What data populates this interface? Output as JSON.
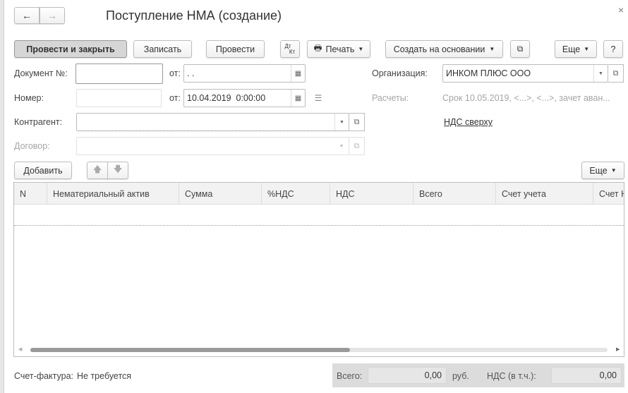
{
  "window": {
    "title": "Поступление НМА (создание)",
    "close": "×"
  },
  "toolbar": {
    "post_close": "Провести и закрыть",
    "save": "Записать",
    "post": "Провести",
    "dtkt_top": "Дт",
    "dtkt_bottom": "Кт",
    "print": "Печать",
    "create_based": "Создать на основании",
    "more": "Еще",
    "help": "?"
  },
  "form": {
    "doc_no_label": "Документ №:",
    "doc_no_value": "",
    "from_label": "от:",
    "doc_date_value": " .  .",
    "number_label": "Номер:",
    "number_value": "",
    "date_value": "10.04.2019  0:00:00",
    "org_label": "Организация:",
    "org_value": "ИНКОМ ПЛЮС ООО",
    "settlements_label": "Расчеты:",
    "settlements_value": "Срок 10.05.2019, <...>, <...>, зачет аван...",
    "counterparty_label": "Контрагент:",
    "counterparty_value": "",
    "vat_link": "НДС сверху",
    "contract_label": "Договор:",
    "contract_value": ""
  },
  "table_toolbar": {
    "add": "Добавить",
    "more": "Еще"
  },
  "table": {
    "columns": [
      "N",
      "Нематериальный актив",
      "Сумма",
      "%НДС",
      "НДС",
      "Всего",
      "Счет учета",
      "Счет НДС"
    ]
  },
  "footer": {
    "invoice_label": "Счет-фактура:",
    "invoice_value": "Не требуется",
    "total_label": "Всего:",
    "total_value": "0,00",
    "currency": "руб.",
    "vat_label": "НДС (в т.ч.):",
    "vat_value": "0,00"
  }
}
